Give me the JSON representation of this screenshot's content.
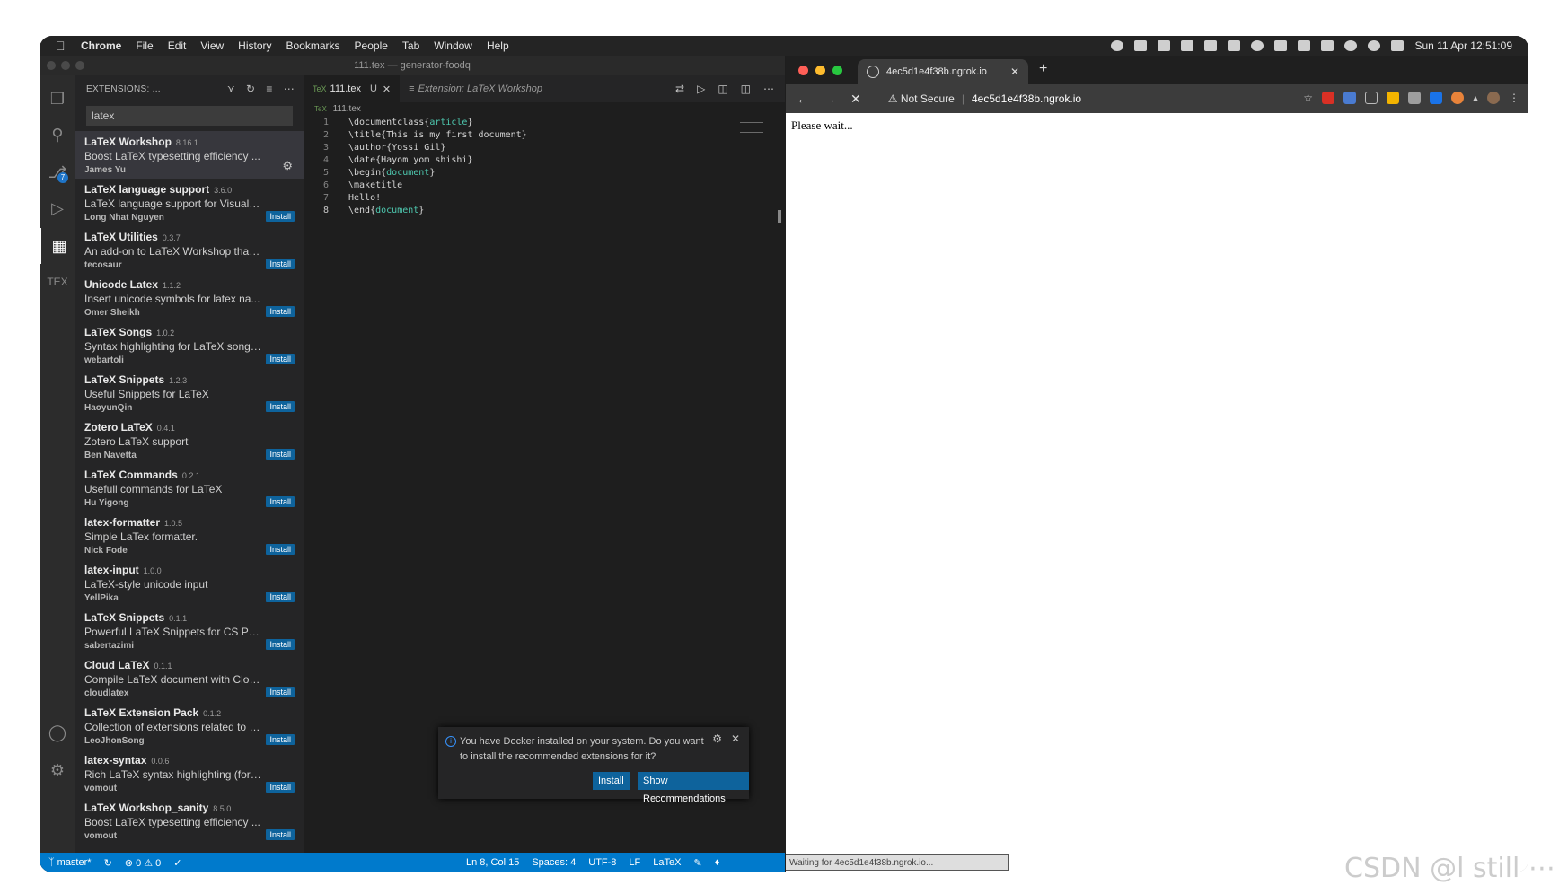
{
  "menubar": {
    "items": [
      "Chrome",
      "File",
      "Edit",
      "View",
      "History",
      "Bookmarks",
      "People",
      "Tab",
      "Window",
      "Help"
    ],
    "clock": "Sun 11 Apr  12:51:09"
  },
  "vscode": {
    "window_title": "111.tex — generator-foodq",
    "sidebar_title": "EXTENSIONS: ...",
    "search_value": "latex",
    "install_label": "Install",
    "extensions": [
      {
        "name": "LaTeX Workshop",
        "version": "8.16.1",
        "desc": "Boost LaTeX typesetting efficiency ...",
        "author": "James Yu",
        "installed": true
      },
      {
        "name": "LaTeX language support",
        "version": "3.6.0",
        "desc": "LaTeX language support for Visual S...",
        "author": "Long Nhat Nguyen"
      },
      {
        "name": "LaTeX Utilities",
        "version": "0.3.7",
        "desc": "An add-on to LaTeX Workshop that ...",
        "author": "tecosaur"
      },
      {
        "name": "Unicode Latex",
        "version": "1.1.2",
        "desc": "Insert unicode symbols for latex na...",
        "author": "Omer Sheikh"
      },
      {
        "name": "LaTeX Songs",
        "version": "1.0.2",
        "desc": "Syntax highlighting for LaTeX songs...",
        "author": "webartoli"
      },
      {
        "name": "LaTeX Snippets",
        "version": "1.2.3",
        "desc": "Useful Snippets for LaTeX",
        "author": "HaoyunQin"
      },
      {
        "name": "Zotero LaTeX",
        "version": "0.4.1",
        "desc": "Zotero LaTeX support",
        "author": "Ben Navetta"
      },
      {
        "name": "LaTeX Commands",
        "version": "0.2.1",
        "desc": "Usefull commands for LaTeX",
        "author": "Hu Yigong"
      },
      {
        "name": "latex-formatter",
        "version": "1.0.5",
        "desc": "Simple LaTex formatter.",
        "author": "Nick Fode"
      },
      {
        "name": "latex-input",
        "version": "1.0.0",
        "desc": "LaTeX-style unicode input",
        "author": "YellPika"
      },
      {
        "name": "LaTeX Snippets",
        "version": "0.1.1",
        "desc": "Powerful LaTeX Snippets for CS Pap...",
        "author": "sabertazimi"
      },
      {
        "name": "Cloud LaTeX",
        "version": "0.1.1",
        "desc": "Compile LaTeX document with Clou...",
        "author": "cloudlatex"
      },
      {
        "name": "LaTeX Extension Pack",
        "version": "0.1.2",
        "desc": "Collection of extensions related to L...",
        "author": "LeoJhonSong"
      },
      {
        "name": "latex-syntax",
        "version": "0.0.6",
        "desc": "Rich LaTeX syntax highlighting (for ...",
        "author": "vomout"
      },
      {
        "name": "LaTeX Workshop_sanity",
        "version": "8.5.0",
        "desc": "Boost LaTeX typesetting efficiency ...",
        "author": "vomout"
      }
    ],
    "tabs": {
      "file_tab": "111.tex",
      "file_state": "U",
      "ext_tab": "Extension: LaTeX Workshop"
    },
    "breadcrumb": "111.tex",
    "code_lines": [
      {
        "n": "1",
        "pre": "\\documentclass{",
        "arg": "article",
        "post": "}"
      },
      {
        "n": "2",
        "pre": "\\title{This is my first document}",
        "arg": "",
        "post": ""
      },
      {
        "n": "3",
        "pre": "\\author{Yossi Gil}",
        "arg": "",
        "post": ""
      },
      {
        "n": "4",
        "pre": "\\date{Hayom yom shishi}",
        "arg": "",
        "post": ""
      },
      {
        "n": "5",
        "pre": "\\begin{",
        "arg": "document",
        "post": "}"
      },
      {
        "n": "6",
        "pre": "\\maketitle",
        "arg": "",
        "post": ""
      },
      {
        "n": "7",
        "pre": "Hello!",
        "arg": "",
        "post": ""
      },
      {
        "n": "8",
        "pre": "\\end{",
        "arg": "document",
        "post": "}"
      }
    ],
    "notification": {
      "message": "You have Docker installed on your system. Do you want to install the recommended extensions for it?",
      "install": "Install",
      "show_recs": "Show Recommendations"
    },
    "status": {
      "branch": "master*",
      "errors": "0",
      "warnings": "0",
      "position": "Ln 8, Col 15",
      "spaces": "Spaces: 4",
      "encoding": "UTF-8",
      "eol": "LF",
      "language": "LaTeX",
      "scm_badge": "7"
    }
  },
  "chrome": {
    "tab_title": "4ec5d1e4f38b.ngrok.io",
    "security": "Not Secure",
    "url": "4ec5d1e4f38b.ngrok.io",
    "page_text": "Please wait...",
    "status_text": "Waiting for 4ec5d1e4f38b.ngrok.io..."
  },
  "watermark": "CSDN @l still ⋯"
}
